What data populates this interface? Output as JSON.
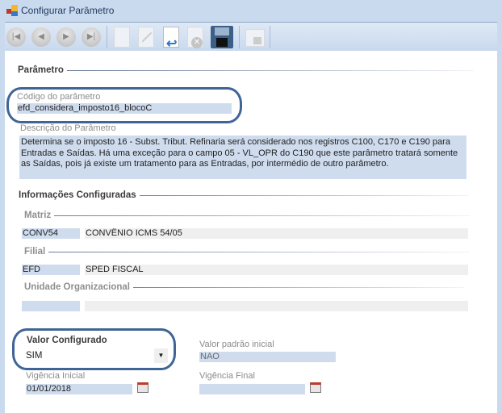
{
  "window": {
    "title": "Configurar Parâmetro"
  },
  "toolbar": {
    "buttons": [
      {
        "name": "first-record-button",
        "icon": "skip-back-icon"
      },
      {
        "name": "previous-record-button",
        "icon": "arrow-left-icon"
      },
      {
        "name": "next-record-button",
        "icon": "arrow-right-icon"
      },
      {
        "name": "last-record-button",
        "icon": "skip-forward-icon"
      },
      {
        "name": "new-button",
        "icon": "new-document-icon"
      },
      {
        "name": "edit-button",
        "icon": "edit-icon"
      },
      {
        "name": "undo-button",
        "icon": "undo-icon"
      },
      {
        "name": "delete-button",
        "icon": "delete-icon"
      },
      {
        "name": "save-button",
        "icon": "floppy-disk-icon"
      },
      {
        "name": "lock-button",
        "icon": "lock-icon"
      }
    ]
  },
  "parametro": {
    "header": "Parâmetro",
    "codigo_label": "Código do parâmetro",
    "codigo_value": "efd_considera_imposto16_blocoC",
    "descricao_label": "Descrição do Parâmetro",
    "descricao_value": "Determina se o imposto 16 - Subst. Tribut. Refinaria será considerado nos registros C100, C170 e C190 para Entradas e Saídas. Há uma exceção para o campo 05 - VL_OPR  do C190 que este parâmetro tratará somente as Saídas, pois já existe um tratamento para as Entradas, por intermédio de outro parâmetro."
  },
  "info": {
    "header": "Informações Configuradas",
    "matriz_label": "Matriz",
    "matriz_code": "CONV54",
    "matriz_desc": "CONVÊNIO ICMS 54/05",
    "filial_label": "Filial",
    "filial_code": "EFD",
    "filial_desc": "SPED FISCAL",
    "unidade_label": "Unidade Organizacional",
    "unidade_code": "",
    "unidade_desc": ""
  },
  "valor": {
    "label": "Valor Configurado",
    "value": "SIM",
    "padrao_label": "Valor padrão inicial",
    "padrao_value": "NAO",
    "vig_ini_label": "Vigência Inicial",
    "vig_ini_value": "01/01/2018",
    "vig_fim_label": "Vigência Final",
    "vig_fim_value": ""
  }
}
